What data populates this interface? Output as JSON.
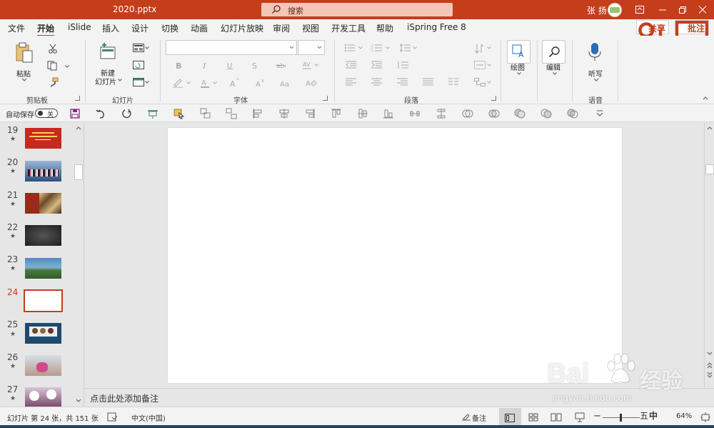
{
  "window": {
    "title": "2020.pptx",
    "search_placeholder": "搜索",
    "user_name": "张 扬"
  },
  "menu": {
    "tabs": [
      "文件",
      "开始",
      "iSlide",
      "插入",
      "设计",
      "切换",
      "动画",
      "幻灯片放映",
      "审阅",
      "视图",
      "开发工具",
      "帮助",
      "iSpring Free 8"
    ],
    "active_tab": "开始",
    "share_label": "共享",
    "comment_label": "批注"
  },
  "ribbon": {
    "clipboard": {
      "paste_label": "粘贴",
      "group_label": "剪贴板"
    },
    "slides": {
      "new_slide_label_1": "新建",
      "new_slide_label_2": "幻灯片",
      "group_label": "幻灯片"
    },
    "font": {
      "font_name": "",
      "font_size": "",
      "group_label": "字体"
    },
    "paragraph": {
      "group_label": "段落"
    },
    "drawing": {
      "label": "绘图"
    },
    "editing": {
      "label": "编辑"
    },
    "voice": {
      "dictate_label": "听写",
      "group_label": "语音"
    }
  },
  "qat": {
    "autosave_label": "自动保存",
    "autosave_state": "关"
  },
  "slides_pane": {
    "thumbnails": [
      {
        "number": "19",
        "star": "★",
        "color": "#c8281e"
      },
      {
        "number": "20",
        "star": "★",
        "color": "#2f4f7a"
      },
      {
        "number": "21",
        "star": "★",
        "color": "#9a2a1a"
      },
      {
        "number": "22",
        "star": "★",
        "color": "#3a3a3a"
      },
      {
        "number": "23",
        "star": "★",
        "color": "#3f7ab0"
      },
      {
        "number": "24",
        "star": "",
        "color": "#ffffff"
      },
      {
        "number": "25",
        "star": "★",
        "color": "#1e4a6e"
      },
      {
        "number": "26",
        "star": "★",
        "color": "#b89a8a"
      },
      {
        "number": "27",
        "star": "★",
        "color": "#7a4a6a"
      }
    ],
    "active_slide": "24"
  },
  "notes": {
    "placeholder": "点击此处添加备注"
  },
  "status": {
    "slide_info": "幻灯片 第 24 张，共 151 张",
    "language": "中文(中国)",
    "notes_label": "备注",
    "zoom": "64%",
    "ime_1": "五",
    "ime_2": "中"
  },
  "watermark": {
    "brand": "Bai",
    "brand_cn": "经验",
    "url": "jingyan.baidu.com"
  }
}
